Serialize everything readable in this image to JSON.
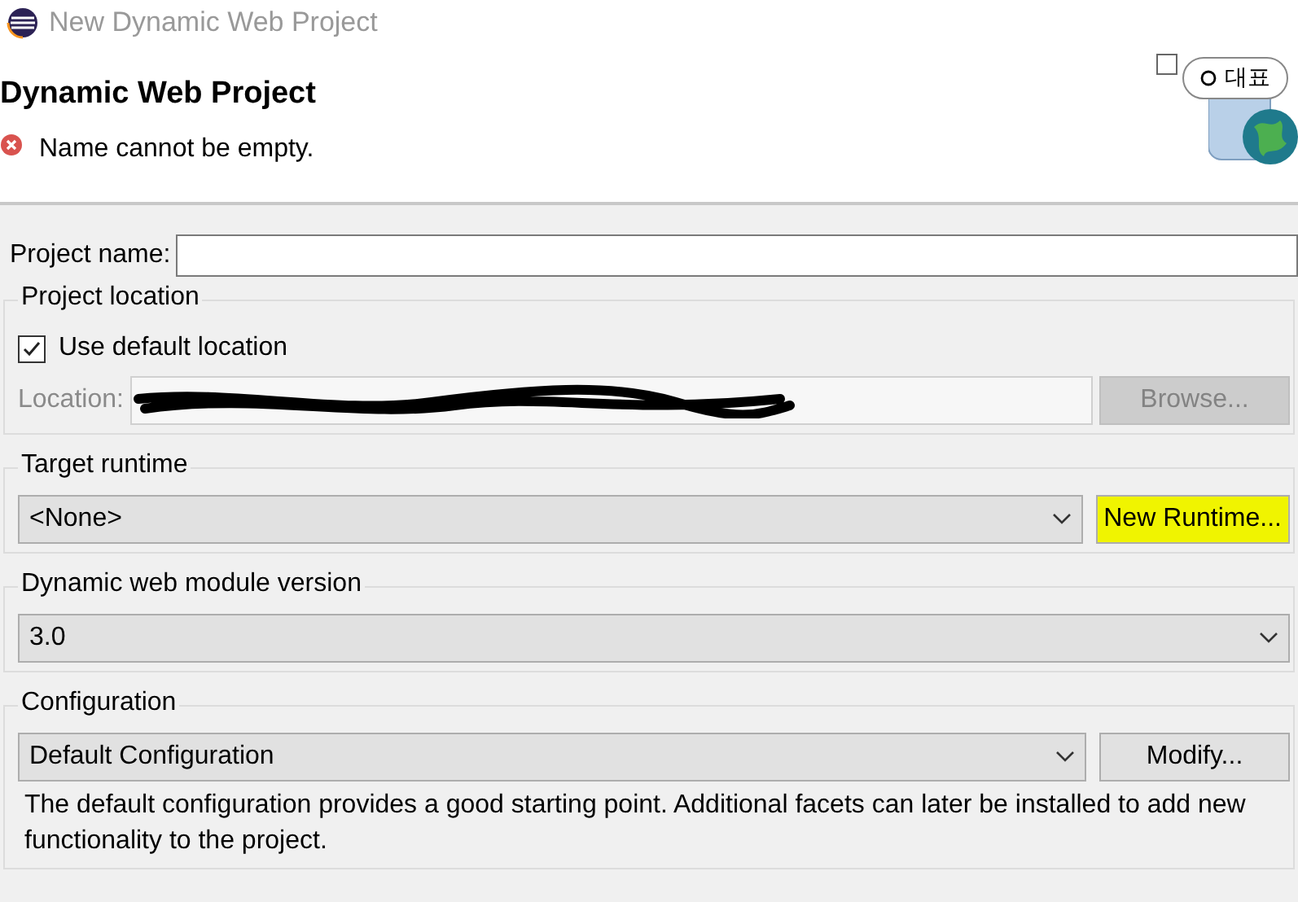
{
  "window": {
    "title": "New Dynamic Web Project"
  },
  "overlay_button": {
    "label": "대표"
  },
  "header": {
    "title": "Dynamic Web Project",
    "message": "Name cannot be empty.",
    "message_is_error": true
  },
  "project_name": {
    "label": "Project name:"
  },
  "project_location": {
    "title": "Project location",
    "use_default": {
      "label": "Use default location",
      "checked": true
    },
    "location_label": "Location:",
    "location_redacted": true,
    "browse_button": {
      "label": "Browse...",
      "disabled": true
    }
  },
  "target_runtime": {
    "title": "Target runtime",
    "value": "<None>",
    "button": {
      "label": "New Runtime...",
      "highlighted": true
    }
  },
  "module_version": {
    "title": "Dynamic web module version",
    "value": "3.0"
  },
  "configuration": {
    "title": "Configuration",
    "value": "Default Configuration",
    "button": {
      "label": "Modify..."
    },
    "description": "The default configuration provides a good starting point. Additional facets can later be installed to add new functionality to the project."
  }
}
